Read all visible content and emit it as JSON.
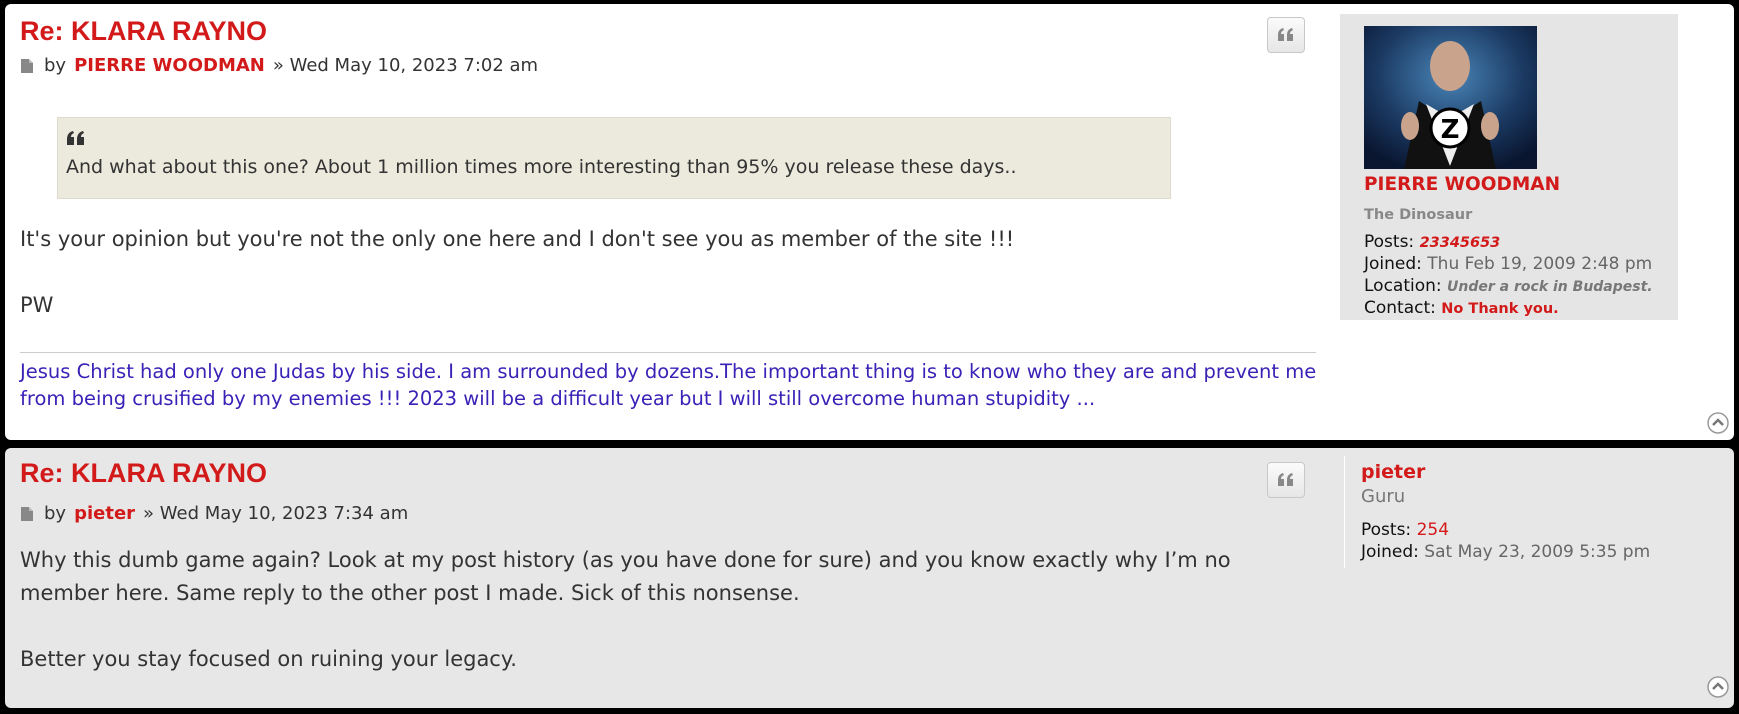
{
  "post1": {
    "title": "Re: KLARA RAYNO",
    "by": "by",
    "author": "PIERRE WOODMAN",
    "datetime": "» Wed May 10, 2023 7:02 am",
    "quote": "And what about this one? About 1 million times more interesting than 95% you release these days..",
    "body1": "It's your opinion but you're not the only one here and I don't see you as member of the site !!!",
    "body2": "PW",
    "signature": "Jesus Christ had only one Judas by his side. I am surrounded by dozens.The important thing is to know who they are and prevent me from being crusified by my enemies !!! 2023 will be a difficult year but I will still overcome human stupidity ...",
    "profile": {
      "name": "PIERRE WOODMAN",
      "rank": "The Dinosaur",
      "posts_label": "Posts:",
      "posts_value": "23345653",
      "joined_label": "Joined:",
      "joined_value": "Thu Feb 19, 2009 2:48 pm",
      "location_label": "Location:",
      "location_value": "Under a rock in Budapest.",
      "contact_label": "Contact:",
      "contact_value": "No Thank you."
    }
  },
  "post2": {
    "title": "Re: KLARA RAYNO",
    "by": "by",
    "author": "pieter",
    "datetime": "» Wed May 10, 2023 7:34 am",
    "body1": "Why this dumb game again? Look at my post history (as you have done for sure) and you know exactly why I’m no member here. Same reply to the other post I made. Sick of this nonsense.",
    "body2": "Better you stay focused on ruining your legacy.",
    "profile": {
      "name": "pieter",
      "rank": "Guru",
      "posts_label": "Posts:",
      "posts_value": "254",
      "joined_label": "Joined:",
      "joined_value": "Sat May 23, 2009 5:35 pm"
    }
  },
  "icons": {
    "quote": "quote-icon",
    "post": "post-document-icon",
    "top": "back-to-top-icon"
  },
  "colors": {
    "accent": "#d31a1a",
    "signature": "#3a22b7",
    "quote_bg": "#ebeadd",
    "post2_bg": "#e7e7e7"
  }
}
